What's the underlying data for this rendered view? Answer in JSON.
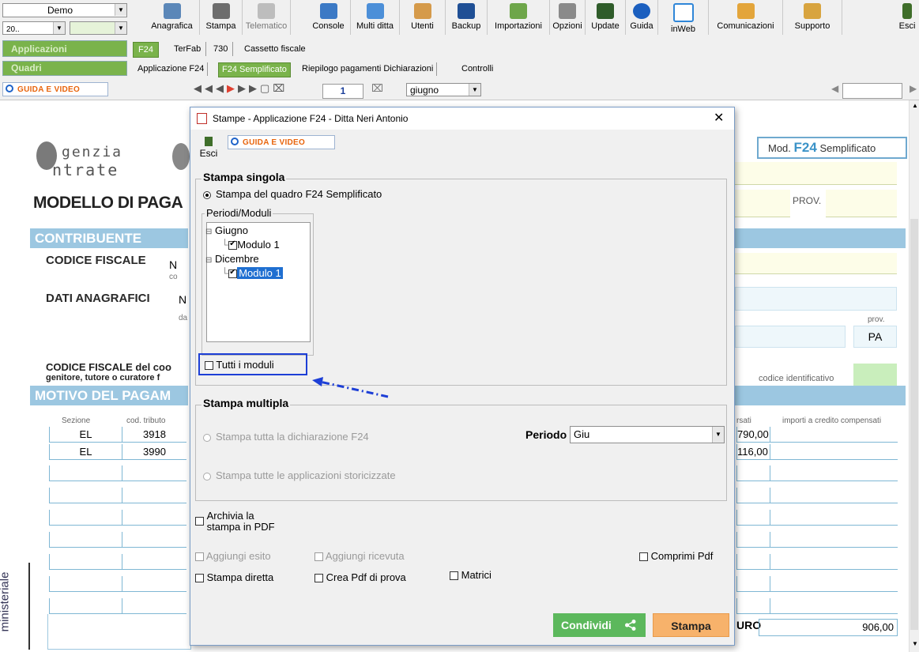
{
  "toolbar": {
    "company_combo": "Demo",
    "year_combo": "20..",
    "section_applicazioni": "Applicazioni",
    "section_quadri": "Quadri",
    "buttons": [
      "Anagrafica",
      "Stampa",
      "Telematico",
      "Console",
      "Multi ditta",
      "Utenti",
      "Backup",
      "Importazioni",
      "Opzioni",
      "Update",
      "Guida",
      "inWeb",
      "Comunicazioni",
      "Supporto",
      "Esci"
    ],
    "tabs": [
      "F24",
      "TerFab",
      "730",
      "Cassetto fiscale"
    ],
    "subtabs": [
      "Applicazione F24",
      "F24 Semplificato",
      "Riepilogo pagamenti Dichiarazioni",
      "Controlli"
    ]
  },
  "nav": {
    "guide_label": "GUIDA E VIDEO",
    "page_number": "1",
    "month": "giugno"
  },
  "form": {
    "logo_line1": "genzia",
    "logo_line2": "ntrate",
    "model_label_pre": "Mod.",
    "model_label_f24": "F24",
    "model_label_post": "Semplificato",
    "title": "MODELLO DI PAGA",
    "prov_label": "PROV.",
    "contribuente": "CONTRIBUENTE",
    "codice_fiscale": "CODICE FISCALE",
    "cf_value": "N",
    "cf_sub": "co",
    "dati_anagrafici": "DATI ANAGRAFICI",
    "da_value": "N",
    "da_sub": "da",
    "prov_small": "prov.",
    "prov_value": "PA",
    "cf_genitore_1": "CODICE FISCALE del coo",
    "cf_genitore_2": "genitore, tutore o curatore f",
    "codice_identificativo": "codice identificativo",
    "motivo": "MOTIVO DEL PAGAM",
    "col_sezione": "Sezione",
    "col_tributo": "cod. tributo",
    "col_compensati": "rsati",
    "col_credito": "importi a credito compensati",
    "rows": [
      {
        "sezione": "EL",
        "tributo": "3918",
        "importo": "790,00"
      },
      {
        "sezione": "EL",
        "tributo": "3990",
        "importo": "116,00"
      }
    ],
    "euro_label": "URO",
    "total": "906,00",
    "side_label": "ministeriale"
  },
  "dialog": {
    "title": "Stampe - Applicazione F24 - Ditta  Neri Antonio",
    "esci": "Esci",
    "guide_label": "GUIDA E VIDEO",
    "stampa_singola": "Stampa singola",
    "radio_quadro": "Stampa del quadro F24 Semplificato",
    "periodi_moduli": "Periodi/Moduli",
    "tree": [
      {
        "label": "Giugno",
        "child": "Modulo 1",
        "checked": true,
        "selected": false
      },
      {
        "label": "Dicembre",
        "child": "Modulo 1",
        "checked": true,
        "selected": true
      }
    ],
    "tutti_moduli": "Tutti i moduli",
    "stampa_multipla": "Stampa multipla",
    "radio_dichiarazione": "Stampa tutta la dichiarazione F24",
    "periodo_label": "Periodo",
    "periodo_value": "Giu",
    "radio_storicizzate": "Stampa tutte le applicazioni storicizzate",
    "archivia_1": "Archivia la",
    "archivia_2": "stampa in PDF",
    "aggiungi_esito": "Aggiungi esito",
    "aggiungi_ricevuta": "Aggiungi ricevuta",
    "comprimi_pdf": "Comprimi Pdf",
    "stampa_diretta": "Stampa diretta",
    "crea_pdf_prova": "Crea Pdf di prova",
    "matrici": "Matrici",
    "condividi": "Condividi",
    "stampa": "Stampa",
    "colors": {
      "accent_green": "#5cb85c",
      "stampa_orange": "#f7b26b",
      "highlight_blue": "#1d3fd6"
    }
  }
}
